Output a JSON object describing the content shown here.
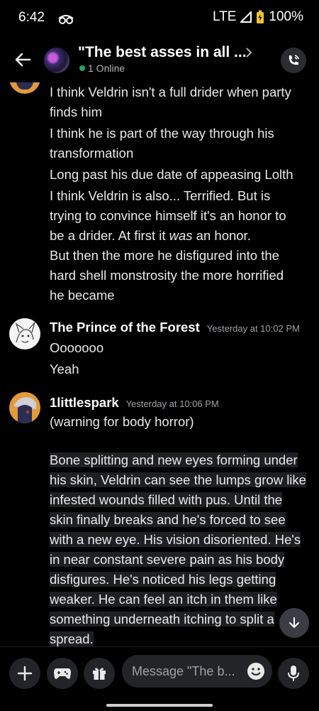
{
  "status_bar": {
    "time": "6:42",
    "network": "LTE",
    "battery": "100%"
  },
  "header": {
    "title": "\"The best asses in all ...",
    "online": "1 Online"
  },
  "messages_top": [
    "I think Veldrin isn't a full drider when party",
    "finds him",
    "I think he is part of the way through his",
    "transformation",
    "Long past his due date of appeasing Lolth",
    "I think Veldrin is also... Terrified. But is",
    "trying to convince himself it's an honor to",
    "be a drider. At first it ",
    "was",
    " an honor.",
    "But then the more he disfigured into the",
    "hard shell monstrosity the more horrified",
    "he became"
  ],
  "prince": {
    "name": "The Prince of the Forest",
    "time": "Yesterday at 10:02 PM",
    "lines": [
      "Ooooooo",
      "Yeah"
    ]
  },
  "spark": {
    "name": "1littlespark",
    "time": "Yesterday at 10:06 PM",
    "lines": [
      "(warning for body horror)"
    ],
    "highlighted": [
      "Bone splitting and new eyes forming under",
      "his skin, Veldrin can see the lumps grow like",
      "infested wounds filled with pus. Until the",
      "skin finally breaks and he's forced to see",
      "with a new eye. His vision disoriented. He's",
      "in near constant severe pain as his body",
      "disfigures. He's noticed his legs getting",
      "weaker. He can feel an itch in them like",
      "something underneath itching to split a",
      "spread."
    ]
  },
  "composer": {
    "placeholder": "Message \"The b..."
  }
}
